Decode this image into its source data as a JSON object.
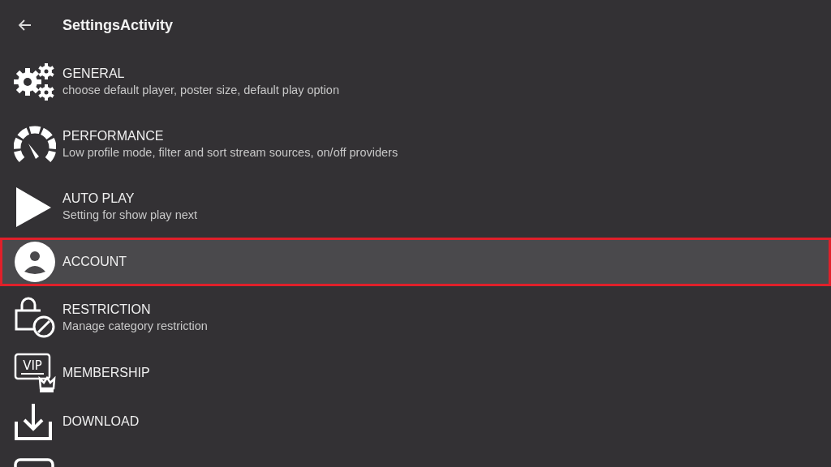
{
  "app_bar": {
    "title": "SettingsActivity"
  },
  "settings": [
    {
      "title": "GENERAL",
      "summary": "choose default player, poster size, default play option",
      "selected": false
    },
    {
      "title": "PERFORMANCE",
      "summary": "Low profile mode, filter and sort stream sources, on/off providers",
      "selected": false
    },
    {
      "title": "AUTO PLAY",
      "summary": "Setting for show play next",
      "selected": false
    },
    {
      "title": "ACCOUNT",
      "selected": true
    },
    {
      "title": "RESTRICTION",
      "summary": "Manage category restriction",
      "selected": false
    },
    {
      "title": "MEMBERSHIP",
      "icon_text": "VIP",
      "selected": false
    },
    {
      "title": "DOWNLOAD",
      "selected": false
    },
    {
      "selected": false
    }
  ]
}
